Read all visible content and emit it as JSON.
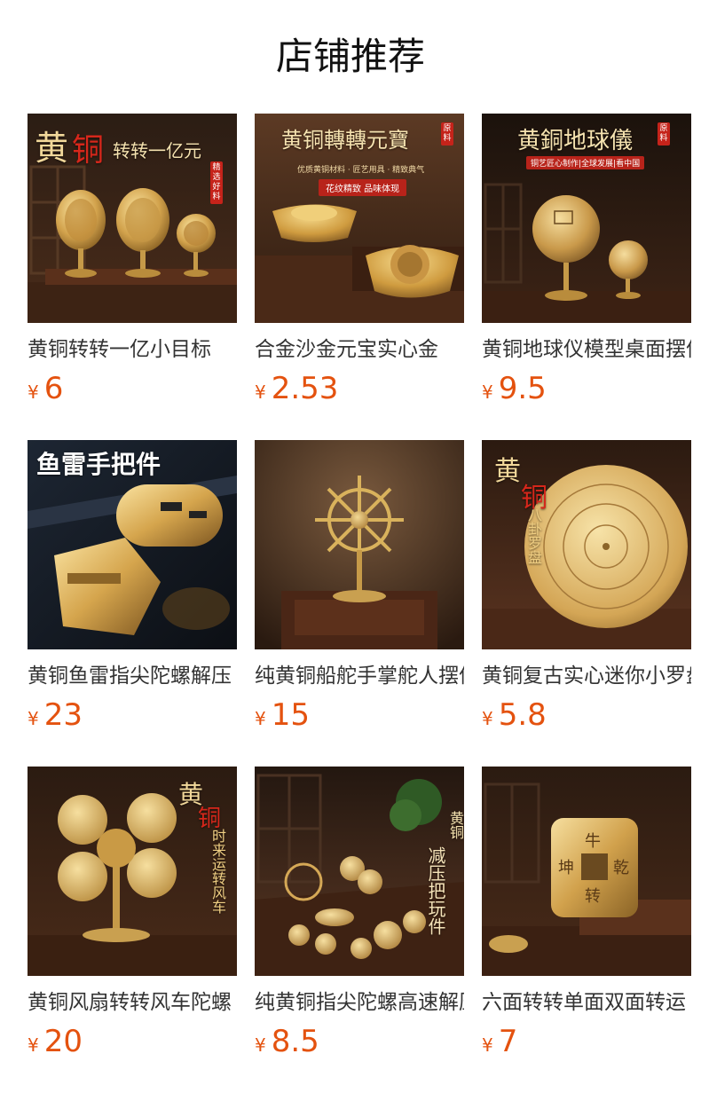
{
  "header": {
    "title": "店铺推荐"
  },
  "colors": {
    "price": "#e4520f",
    "gold": "#d9b25c",
    "seal_red": "#c5231a"
  },
  "products": [
    {
      "name": "黄铜转转一亿小目标",
      "currency": "¥",
      "price": "6",
      "image": {
        "title_a": "黄",
        "title_b": "铜",
        "title_c": "转转一亿元",
        "seal": "精选好料"
      }
    },
    {
      "name": "合金沙金元宝实心金",
      "currency": "¥",
      "price": "2.53",
      "image": {
        "title": "黄铜轉轉元寶",
        "seal": "原料",
        "tagline": "优质黄铜材料 · 匠艺用具 · 精致典气",
        "banner": "花纹精致 品味体现"
      }
    },
    {
      "name": "黄铜地球仪模型桌面摆件",
      "currency": "¥",
      "price": "9.5",
      "image": {
        "title": "黄銅地球儀",
        "seal": "原料",
        "banner": "铜艺匠心制作|全球发展|看中国"
      }
    },
    {
      "name": "黄铜鱼雷指尖陀螺解压",
      "currency": "¥",
      "price": "23",
      "image": {
        "title": "鱼雷手把件"
      }
    },
    {
      "name": "纯黄铜船舵手掌舵人摆件",
      "currency": "¥",
      "price": "15",
      "image": {}
    },
    {
      "name": "黄铜复古实心迷你小罗盘",
      "currency": "¥",
      "price": "5.8",
      "image": {
        "title_a": "黄",
        "title_b": "铜",
        "title_c": "八卦罗盘"
      }
    },
    {
      "name": "黄铜风扇转转风车陀螺",
      "currency": "¥",
      "price": "20",
      "image": {
        "title_a": "黄",
        "title_b": "铜",
        "title_c": "时来运转风车"
      }
    },
    {
      "name": "纯黄铜指尖陀螺高速解压",
      "currency": "¥",
      "price": "8.5",
      "image": {
        "title": "黄铜",
        "subtitle": "减压把玩件"
      }
    },
    {
      "name": "六面转转单面双面转运",
      "currency": "¥",
      "price": "7",
      "image": {
        "coin_text": [
          "牛",
          "乾",
          "坤",
          "转"
        ]
      }
    }
  ]
}
